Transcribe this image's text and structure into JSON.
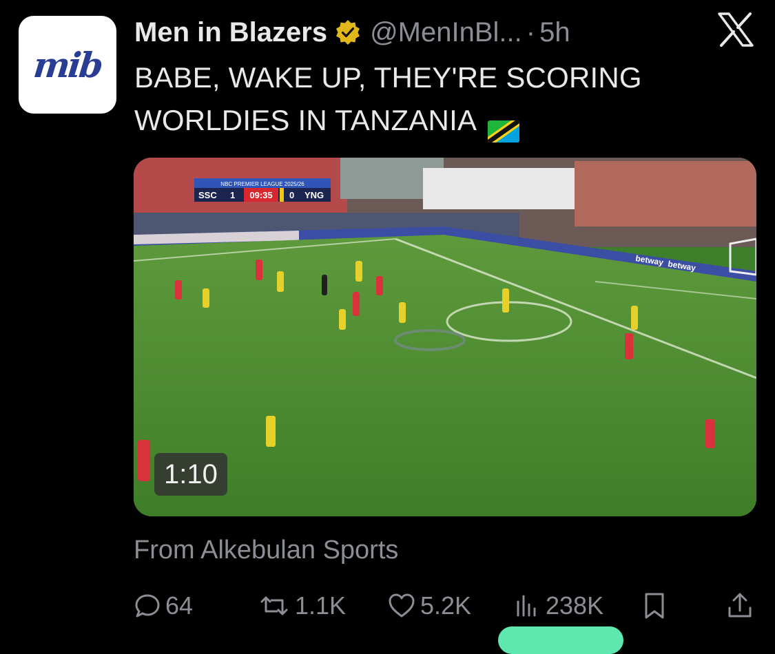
{
  "author": {
    "avatar_text": "mib",
    "name": "Men in Blazers",
    "handle": "@MenInBl...",
    "separator": "·",
    "time": "5h"
  },
  "tweet": {
    "text": "BABE, WAKE UP, THEY'RE SCORING WORLDIES IN TANZANIA",
    "flag_icon": "tanzania-flag-emoji"
  },
  "video": {
    "duration": "1:10",
    "scoreboard": {
      "league": "NBC PREMIER LEAGUE 2025/26",
      "home": "SSC",
      "home_score": "1",
      "clock": "09:35",
      "away_score": "0",
      "away": "YNG"
    },
    "ad_boards": [
      "betway",
      "betway"
    ]
  },
  "source": "From Alkebulan Sports",
  "actions": {
    "reply": "64",
    "repost": "1.1K",
    "like": "5.2K",
    "views": "238K"
  },
  "colors": {
    "background": "#000000",
    "text": "#e7e9ea",
    "muted": "#8b8f95",
    "verified": "#e2b719",
    "brand": "#2a3d94",
    "highlight": "#5ee8b0"
  }
}
